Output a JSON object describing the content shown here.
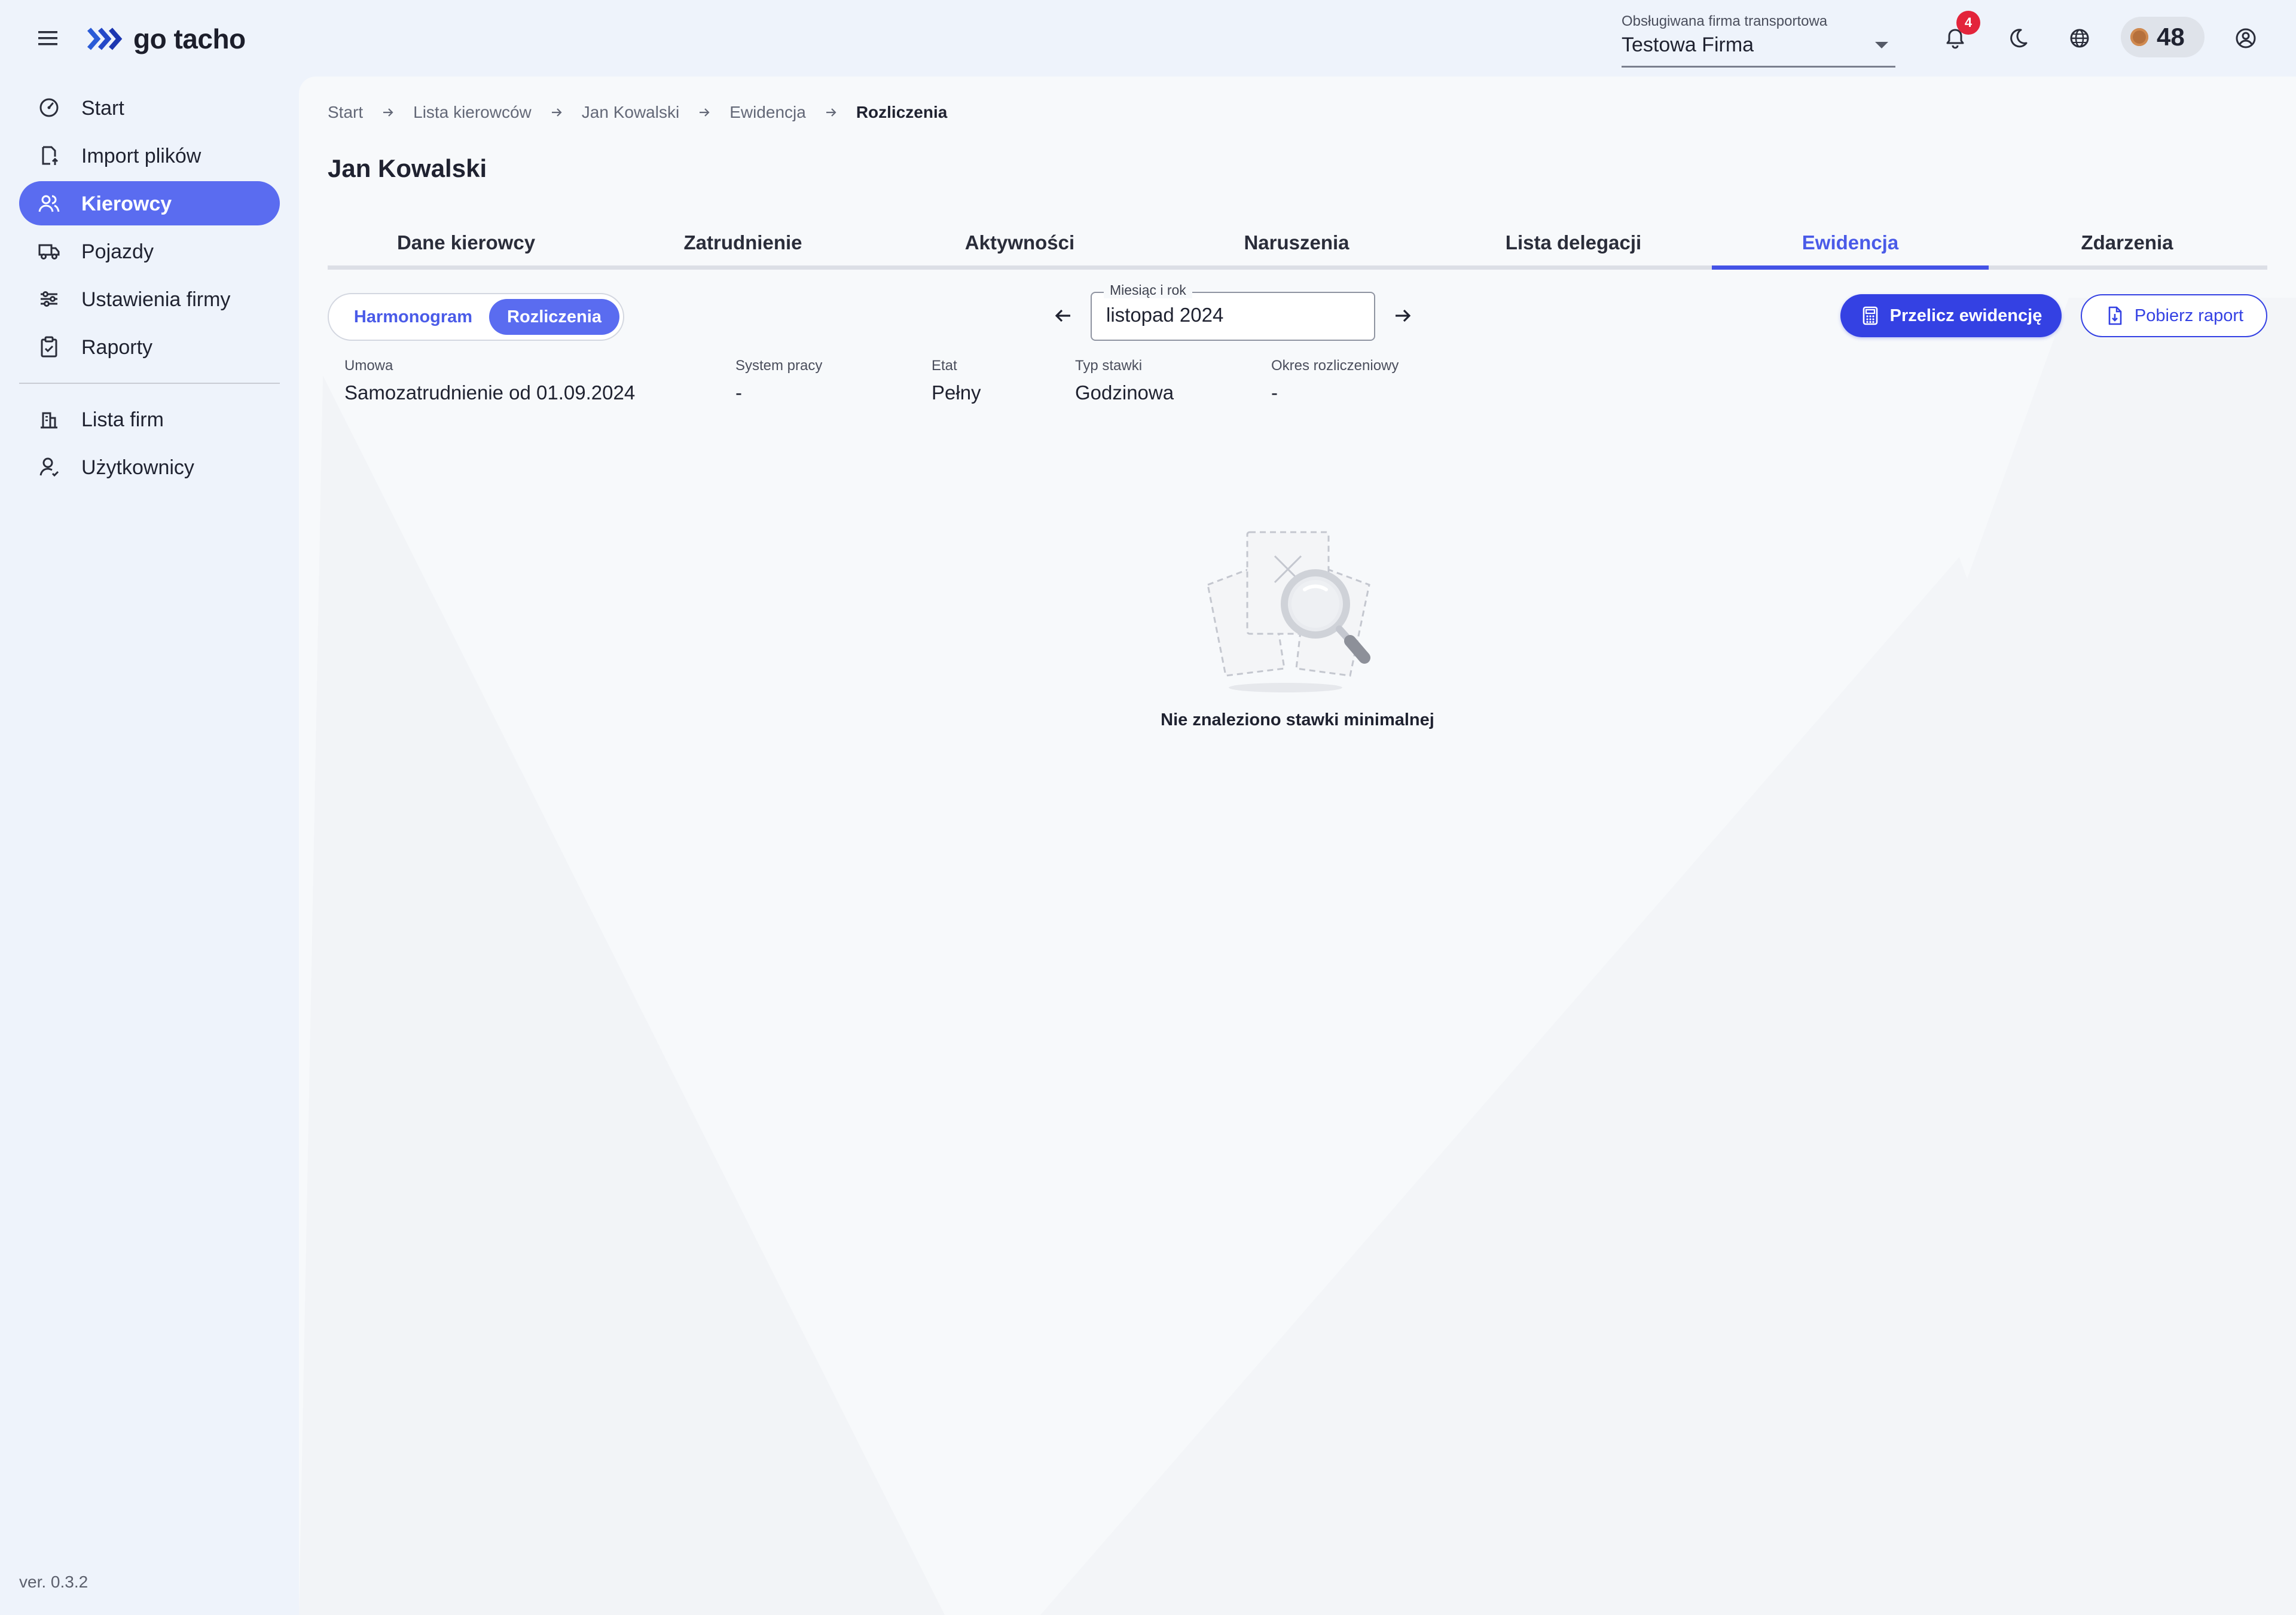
{
  "app": {
    "logo_text": "go tacho",
    "version": "ver. 0.3.2"
  },
  "topbar": {
    "company_label": "Obsługiwana firma transportowa",
    "company_value": "Testowa Firma",
    "notification_count": "4",
    "coins": "48",
    "icons": [
      "bell-icon",
      "moon-icon",
      "globe-icon",
      "account-icon"
    ]
  },
  "sidebar": {
    "items": [
      {
        "label": "Start",
        "icon": "dashboard-icon",
        "active": false
      },
      {
        "label": "Import plików",
        "icon": "file-import-icon",
        "active": false
      },
      {
        "label": "Kierowcy",
        "icon": "users-icon",
        "active": true
      },
      {
        "label": "Pojazdy",
        "icon": "truck-icon",
        "active": false
      },
      {
        "label": "Ustawienia firmy",
        "icon": "sliders-icon",
        "active": false
      },
      {
        "label": "Raporty",
        "icon": "clipboard-icon",
        "active": false
      }
    ],
    "secondary_items": [
      {
        "label": "Lista firm",
        "icon": "building-icon"
      },
      {
        "label": "Użytkownicy",
        "icon": "user-icon"
      }
    ]
  },
  "breadcrumb": [
    "Start",
    "Lista kierowców",
    "Jan Kowalski",
    "Ewidencja",
    "Rozliczenia"
  ],
  "page": {
    "title": "Jan Kowalski"
  },
  "tabs": [
    {
      "label": "Dane kierowcy",
      "active": false
    },
    {
      "label": "Zatrudnienie",
      "active": false
    },
    {
      "label": "Aktywności",
      "active": false
    },
    {
      "label": "Naruszenia",
      "active": false
    },
    {
      "label": "Lista delegacji",
      "active": false
    },
    {
      "label": "Ewidencja",
      "active": true
    },
    {
      "label": "Zdarzenia",
      "active": false
    }
  ],
  "toggle": {
    "options": [
      "Harmonogram",
      "Rozliczenia"
    ],
    "selected": "Rozliczenia"
  },
  "month_picker": {
    "label": "Miesiąc i rok",
    "value": "listopad 2024"
  },
  "actions": {
    "recalculate": "Przelicz ewidencję",
    "download": "Pobierz raport"
  },
  "contract_info": [
    {
      "label": "Umowa",
      "value": "Samozatrudnienie od 01.09.2024"
    },
    {
      "label": "System pracy",
      "value": "-"
    },
    {
      "label": "Etat",
      "value": "Pełny"
    },
    {
      "label": "Typ stawki",
      "value": "Godzinowa"
    },
    {
      "label": "Okres rozliczeniowy",
      "value": "-"
    }
  ],
  "empty_state": {
    "message": "Nie znaleziono stawki minimalnej",
    "icon": "search-empty-icon"
  },
  "colors": {
    "accent": "#5a6cf0",
    "primary_button": "#3441e3",
    "badge": "#e3243b",
    "background": "#eef3fb"
  }
}
